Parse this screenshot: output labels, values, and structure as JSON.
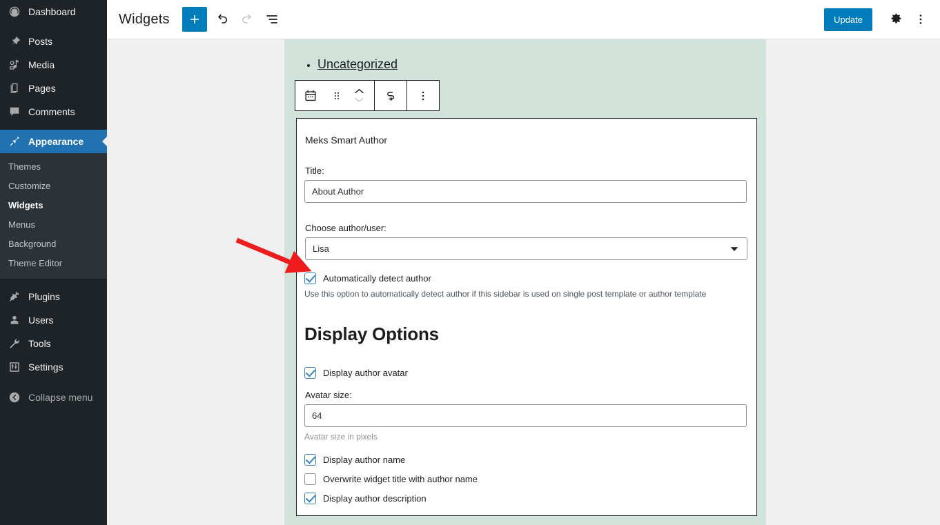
{
  "admin_menu": {
    "items": [
      {
        "label": "Dashboard",
        "icon": "dashboard-icon",
        "current": false,
        "spaced": false
      },
      {
        "label": "Posts",
        "icon": "pin-icon",
        "current": false,
        "spaced": true
      },
      {
        "label": "Media",
        "icon": "media-icon",
        "current": false,
        "spaced": false
      },
      {
        "label": "Pages",
        "icon": "pages-icon",
        "current": false,
        "spaced": false
      },
      {
        "label": "Comments",
        "icon": "comments-icon",
        "current": false,
        "spaced": false
      },
      {
        "label": "Appearance",
        "icon": "appearance-brush-icon",
        "current": true,
        "spaced": true
      }
    ],
    "submenu": [
      {
        "label": "Themes",
        "current": false
      },
      {
        "label": "Customize",
        "current": false
      },
      {
        "label": "Widgets",
        "current": true
      },
      {
        "label": "Menus",
        "current": false
      },
      {
        "label": "Background",
        "current": false
      },
      {
        "label": "Theme Editor",
        "current": false
      }
    ],
    "items_lower": [
      {
        "label": "Plugins",
        "icon": "plugin-icon",
        "spaced": true
      },
      {
        "label": "Users",
        "icon": "users-icon",
        "spaced": false
      },
      {
        "label": "Tools",
        "icon": "tools-wrench-icon",
        "spaced": false
      },
      {
        "label": "Settings",
        "icon": "settings-sliders-icon",
        "spaced": false
      }
    ],
    "collapse": {
      "label": "Collapse menu",
      "icon": "collapse-arrow-icon"
    },
    "accent_current": "#2271b1",
    "background": "#1d2327",
    "submenu_background": "#2c3338"
  },
  "header": {
    "title": "Widgets",
    "add_block_label": "+",
    "add_block_name": "add-block-button",
    "undo_name": "undo-button",
    "redo_name": "redo-button",
    "list_view_name": "list-view-button",
    "update_label": "Update",
    "settings_name": "settings-gear-button",
    "options_name": "more-options-button",
    "primary_color": "#007cba"
  },
  "canvas": {
    "panel_color": "#d2e3dc",
    "category_item": "Uncategorized"
  },
  "block_toolbar": {
    "block_type_icon": "calendar-archives-icon",
    "drag_handle_icon": "drag-handle-icon",
    "move_up_icon": "chevron-up-icon",
    "move_down_icon": "chevron-down-icon",
    "transform_icon": "loop-transform-icon",
    "more_icon": "vertical-ellipsis-icon"
  },
  "widget": {
    "name": "Meks Smart Author",
    "title_label": "Title:",
    "title_value": "About Author",
    "author_label": "Choose author/user:",
    "author_value": "Lisa",
    "auto_detect": {
      "label": "Automatically detect author",
      "checked": true,
      "help": "Use this option to automatically detect author if this sidebar is used on single post template or author template"
    },
    "display_options_heading": "Display Options",
    "display_avatar": {
      "label": "Display author avatar",
      "checked": true
    },
    "avatar_size_label": "Avatar size:",
    "avatar_size_value": "64",
    "avatar_size_help": "Avatar size in pixels",
    "display_name": {
      "label": "Display author name",
      "checked": true
    },
    "overwrite_title": {
      "label": "Overwrite widget title with author name",
      "checked": false
    },
    "display_description": {
      "label": "Display author description",
      "checked": true
    }
  },
  "annotation": {
    "type": "red-arrow",
    "color": "#ee1c1c",
    "points_to": "automatically-detect-author-checkbox"
  }
}
